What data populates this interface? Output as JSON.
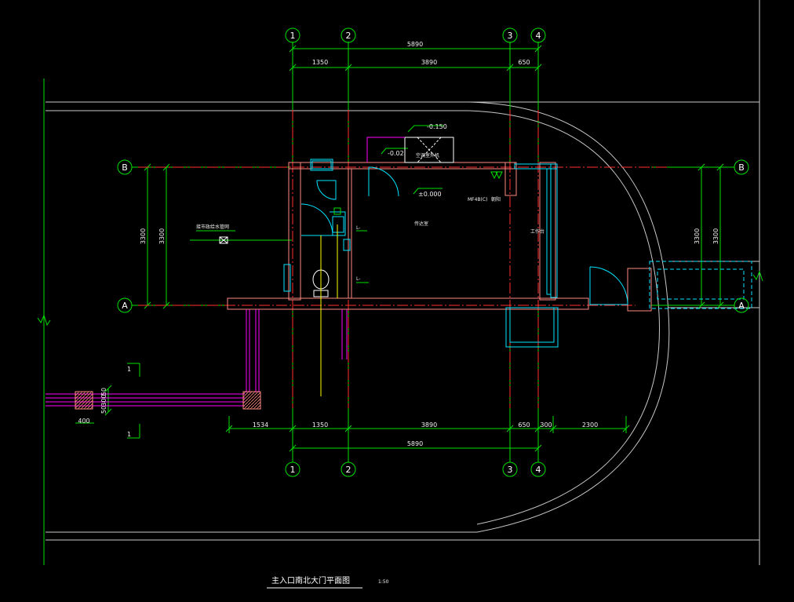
{
  "title": "主入口南北大门平面图",
  "scale": "1:50",
  "axes": {
    "a1": "1",
    "a2": "2",
    "a3": "3",
    "a4": "4",
    "rowA": "A",
    "rowB": "B"
  },
  "dims": {
    "top_total": "5890",
    "top_1": "1350",
    "top_2": "3890",
    "top_3": "650",
    "bottom_1534": "1534",
    "bottom_1350": "1350",
    "bottom_3890": "3890",
    "bottom_650": "650",
    "bottom_300": "300",
    "bottom_2300": "2300",
    "bottom_total": "5890",
    "left_3300_outer": "3300",
    "left_3300_inner": "3300",
    "right_3300_outer": "3300",
    "right_3300_inner": "3300",
    "wall_50_top": "50",
    "wall_300": "300",
    "wall_50_bot": "50",
    "post_400": "400"
  },
  "levels": {
    "lvl_neg015": "-0.150",
    "lvl_neg002": "-0.02",
    "lvl_zero": "±0.000"
  },
  "annotations": {
    "room_name": "传达室",
    "room_code": "MF4B(C)",
    "room_code2": "朝阳",
    "workbench": "工作台",
    "ac_unit": "空调室外机",
    "pipe_note": "接市政给水管网",
    "leader_1": "L-",
    "leader_2": "L-"
  },
  "section_marks": {
    "top": "1",
    "bottom": "1"
  },
  "colors": {
    "grid": "#00ff00",
    "wall": "#ff8080",
    "axis_line": "#ff3030",
    "window": "#00ffff",
    "magenta": "#ff00ff",
    "yellow": "#ffff00",
    "white": "#ffffff",
    "gray": "#c0c0c0"
  }
}
